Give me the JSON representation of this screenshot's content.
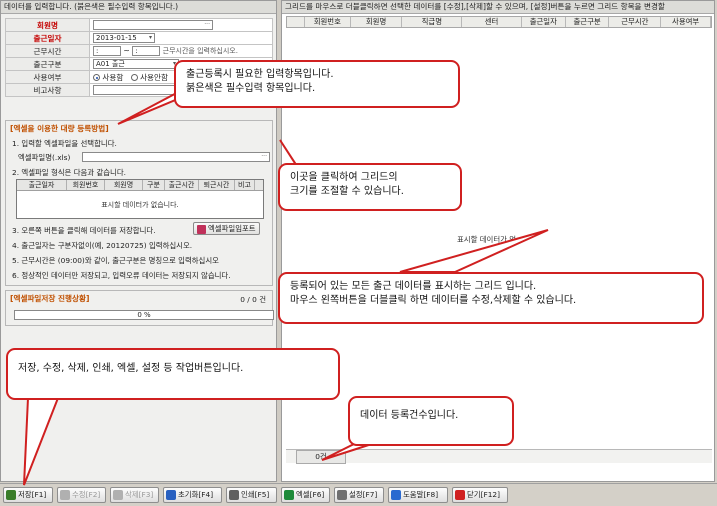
{
  "left_panel": {
    "header": "데이터를 입력합니다. (붉은색은 필수입력 항목입니다.)",
    "form": {
      "member_name_label": "회원명",
      "attend_date_label": "출근일자",
      "attend_date_value": "2013-01-15",
      "work_time_label": "근무시간",
      "work_time_hint": "근무시간을 입력하십시오.",
      "attend_type_label": "출근구분",
      "attend_type_value": "A01 출근",
      "use_label": "사용여부",
      "use_on": "사용함",
      "use_off": "사용안함",
      "note_label": "비고사항"
    },
    "excel": {
      "title": "[엑셀을 이용한 대량 등록방법]",
      "step1": "1. 입력할 엑셀파일을 선택합니다.",
      "file_label": "엑셀파일명(.xls)",
      "step2": "2. 엑셀파일 형식은 다음과 같습니다.",
      "columns": [
        "출근일자",
        "회원번호",
        "회원명",
        "구분",
        "출근시간",
        "퇴근시간",
        "비고"
      ],
      "empty_text": "표시할 데이터가 없습니다.",
      "step3": "3. 오른쪽 버튼을 클릭해 데이터를 저장합니다.",
      "import_button": "엑셀파일임포트",
      "step4": "4. 출근일자는 구분자없이(예, 20120725) 입력하십시오.",
      "step5": "5. 근무시간은 (09:00)와 같이, 출근구분은 명칭으로 입력하십시오",
      "step6": "6. 정상적인 데이터만 저장되고, 입력오류 데이터는 저장되지 않습니다."
    },
    "progress": {
      "title": "[엑셀파일저장 진행상황]",
      "count": "0 / 0 건",
      "percent_text": "0 %",
      "percent": 0
    }
  },
  "right_panel": {
    "header": "그리드를 마우스로 더블클릭하면 선택한 데이터를 [수정],[삭제]할 수 있으며, [설정]버튼을 누르면 그리드 항목을 변경할",
    "columns": [
      "회원번호",
      "회원명",
      "직급명",
      "센터",
      "출근일자",
      "출근구분",
      "근무시간",
      "사용여부"
    ],
    "empty_text": "표시할 데이터가 없",
    "count": "0건"
  },
  "toolbar": {
    "buttons": [
      {
        "label": "저장[F1]",
        "enabled": true,
        "icon": "save-icon",
        "color": "#3a7d2a"
      },
      {
        "label": "수정[F2]",
        "enabled": false,
        "icon": "edit-icon",
        "color": "#b0b0b0"
      },
      {
        "label": "삭제[F3]",
        "enabled": false,
        "icon": "delete-icon",
        "color": "#b0b0b0"
      },
      {
        "label": "초기화[F4]",
        "enabled": true,
        "icon": "reset-icon",
        "color": "#2860c0"
      },
      {
        "label": "인쇄[F5]",
        "enabled": true,
        "icon": "print-icon",
        "color": "#606060"
      },
      {
        "label": "엑셀[F6]",
        "enabled": true,
        "icon": "excel-icon",
        "color": "#1e8a3a"
      },
      {
        "label": "설정[F7]",
        "enabled": true,
        "icon": "gear-icon",
        "color": "#707070"
      },
      {
        "label": "도움말[F8]",
        "enabled": true,
        "icon": "help-icon",
        "color": "#2a6ad0"
      },
      {
        "label": "닫기[F12]",
        "enabled": true,
        "icon": "close-icon",
        "color": "#d02020"
      }
    ]
  },
  "callouts": {
    "input_items": "출근등록시 필요한 입력항목입니다.\n붉은색은 필수입력 항목입니다.",
    "resize": "이곳을 클릭하여 그리드의\n크기를 조절할 수 있습니다.",
    "grid": "등록되어 있는 모든 출근 데이터를 표시하는 그리드 입니다.\n마우스 왼쪽버튼을 더블클릭 하면 데이터를 수정,삭제할 수 있습니다.",
    "buttons": "저장, 수정, 삭제, 인쇄, 엑셀, 설정 등 작업버튼입니다.",
    "count": "데이터 등록건수입니다."
  }
}
